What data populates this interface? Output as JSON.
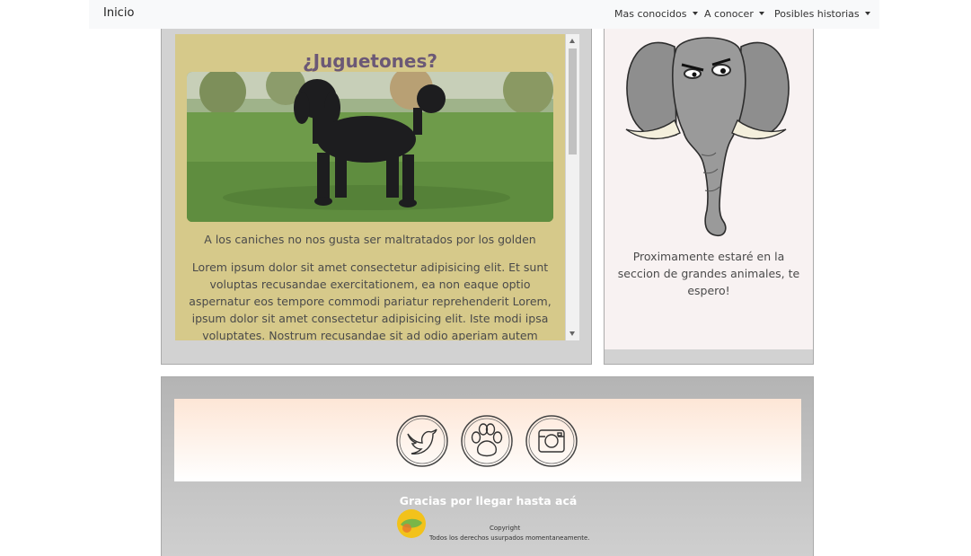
{
  "navbar": {
    "brand": "Inicio",
    "items": [
      {
        "label": "Mas conocidos"
      },
      {
        "label": "A conocer"
      },
      {
        "label": "Posibles historias"
      }
    ]
  },
  "card": {
    "title": "¿Juguetones?",
    "caption": "A los caniches no nos gusta ser maltratados por los golden",
    "body": "Lorem ipsum dolor sit amet consectetur adipisicing elit. Et sunt voluptas recusandae exercitationem, ea non eaque optio aspernatur eos tempore commodi pariatur reprehenderit Lorem, ipsum dolor sit amet consectetur adipisicing elit. Iste modi ipsa voluptates. Nostrum recusandae sit ad odio aperiam autem excepturi, inventore eveniet"
  },
  "side": {
    "text": "Proximamente estaré en la seccion de grandes animales, te espero!"
  },
  "footer": {
    "social_icons": [
      "twitter-icon",
      "paw-icon",
      "instagram-icon"
    ],
    "thanks": "Gracias por llegar hasta acá",
    "copyright": "Copyright",
    "rights": "Todos los derechos usurpados momentaneamente."
  },
  "colors": {
    "card_bg": "#d6c98a",
    "title": "#6b5876",
    "panel_bg": "#d2d2d2",
    "side_bg": "#f8f2f2"
  }
}
